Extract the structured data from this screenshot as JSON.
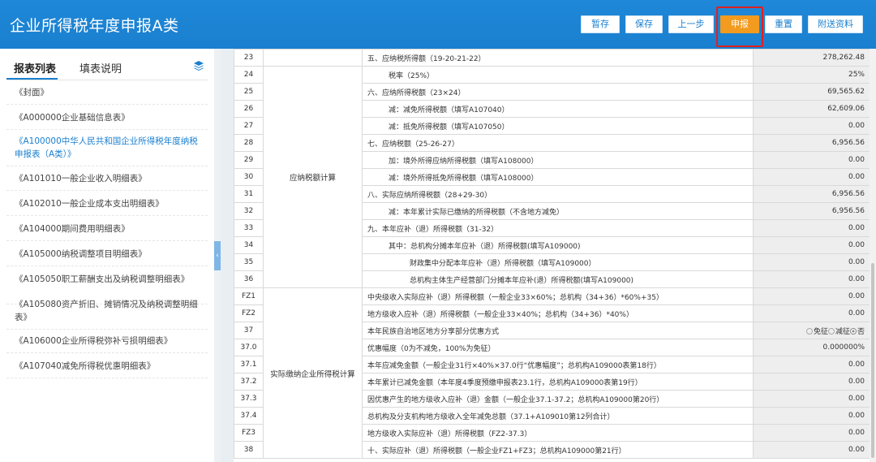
{
  "header": {
    "title": "企业所得税年度申报A类",
    "buttons": {
      "save_draft": "暂存",
      "save": "保存",
      "prev": "上一步",
      "submit": "申报",
      "reset": "重置",
      "attach": "附送资料"
    }
  },
  "sidebar": {
    "tabs": {
      "list": "报表列表",
      "instructions": "填表说明"
    },
    "items": [
      {
        "label": "《封面》"
      },
      {
        "label": "《A000000企业基础信息表》"
      },
      {
        "label": "《A100000中华人民共和国企业所得税年度纳税申报表（A类）》",
        "active": true
      },
      {
        "label": "《A101010一般企业收入明细表》"
      },
      {
        "label": "《A102010一般企业成本支出明细表》"
      },
      {
        "label": "《A104000期间费用明细表》"
      },
      {
        "label": "《A105000纳税调整项目明细表》"
      },
      {
        "label": "《A105050职工薪酬支出及纳税调整明细表》"
      },
      {
        "label": "《A105080资产折旧、摊销情况及纳税调整明细表》"
      },
      {
        "label": "《A106000企业所得税弥补亏损明细表》"
      },
      {
        "label": "《A107040减免所得税优惠明细表》"
      }
    ]
  },
  "table": {
    "categories": {
      "tax_calc": "应纳税额计算",
      "actual": "实际缴纳企业所得税计算"
    },
    "rows": [
      {
        "no": "23",
        "label": "五、应纳税所得额（19-20-21-22）",
        "value": "278,262.48"
      },
      {
        "no": "24",
        "label": "税率（25%）",
        "value": "25%"
      },
      {
        "no": "25",
        "label": "六、应纳所得税额（23×24）",
        "value": "69,565.62"
      },
      {
        "no": "26",
        "label": "减：减免所得税额（填写A107040）",
        "value": "62,609.06"
      },
      {
        "no": "27",
        "label": "减：抵免所得税额（填写A107050）",
        "value": "0.00"
      },
      {
        "no": "28",
        "label": "七、应纳税额（25-26-27）",
        "value": "6,956.56"
      },
      {
        "no": "29",
        "label": "加：境外所得应纳所得税额（填写A108000）",
        "value": "0.00"
      },
      {
        "no": "30",
        "label": "减：境外所得抵免所得税额（填写A108000）",
        "value": "0.00"
      },
      {
        "no": "31",
        "label": "八、实际应纳所得税额（28+29-30）",
        "value": "6,956.56"
      },
      {
        "no": "32",
        "label": "减：本年累计实际已缴纳的所得税额（不含地方减免）",
        "value": "6,956.56"
      },
      {
        "no": "33",
        "label": "九、本年应补（退）所得税额（31-32）",
        "value": "0.00"
      },
      {
        "no": "34",
        "label": "其中：总机构分摊本年应补（退）所得税额(填写A109000)",
        "value": "0.00"
      },
      {
        "no": "35",
        "label": "财政集中分配本年应补（退）所得税额（填写A109000）",
        "value": "0.00"
      },
      {
        "no": "36",
        "label": "总机构主体生产经营部门分摊本年应补(退）所得税额(填写A109000)",
        "value": "0.00"
      },
      {
        "no": "FZ1",
        "label": "中央级收入实际应补（退）所得税额（一般企业33×60%；总机构（34+36）*60%+35）",
        "value": "0.00"
      },
      {
        "no": "FZ2",
        "label": "地方级收入应补（退）所得税额（一般企业33×40%；总机构（34+36）*40%）",
        "value": "0.00"
      },
      {
        "no": "37",
        "label": "本年民族自治地区地方分享部分优惠方式",
        "value": ""
      },
      {
        "no": "37.0",
        "label": "优惠幅度（0为不减免，100%为免征）",
        "value": "0.000000%"
      },
      {
        "no": "37.1",
        "label": "本年应减免金额（一般企业31行×40%×37.0行“优惠幅度”；总机构A109000表第18行）",
        "value": "0.00"
      },
      {
        "no": "37.2",
        "label": "本年累计已减免金额（本年度4季度预缴申报表23.1行，总机构A109000表第19行）",
        "value": "0.00"
      },
      {
        "no": "37.3",
        "label": "因优惠产生的地方级收入应补（退）金额（一般企业37.1-37.2；总机构A109000第20行）",
        "value": "0.00"
      },
      {
        "no": "37.4",
        "label": "总机构及分支机构地方级收入全年减免总额（37.1+A109010第12列合计）",
        "value": "0.00"
      },
      {
        "no": "FZ3",
        "label": "地方级收入实际应补（退）所得税额（FZ2-37.3）",
        "value": "0.00"
      },
      {
        "no": "38",
        "label": "十、实际应补（退）所得税额（一般企业FZ1+FZ3；总机构A109000第21行）",
        "value": "0.00"
      }
    ],
    "preferential_options": {
      "exempt": "免征",
      "reduce": "减征",
      "no": "否",
      "selected": "no"
    }
  }
}
